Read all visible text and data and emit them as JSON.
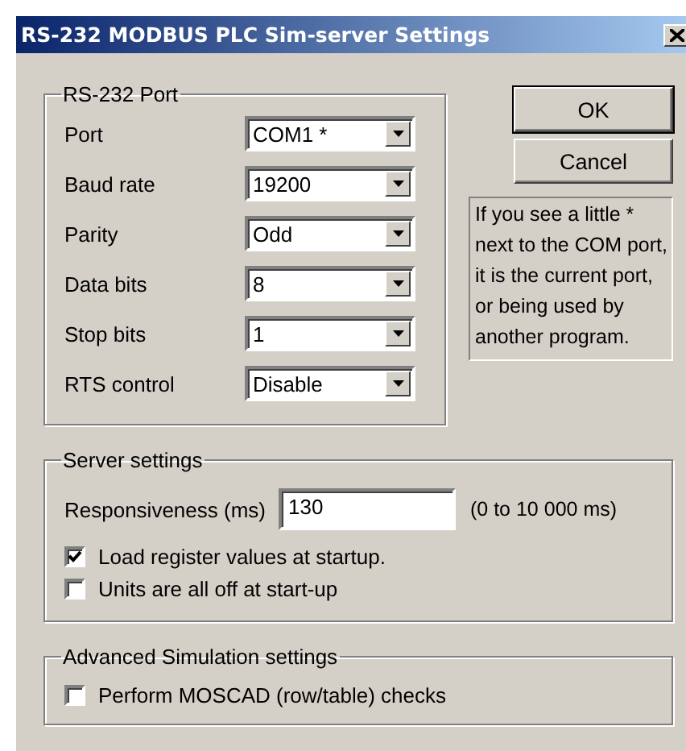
{
  "window": {
    "title": "RS-232 MODBUS PLC Sim-server Settings"
  },
  "port_group": {
    "title": "RS-232 Port",
    "fields": [
      {
        "label": "Port",
        "value": "COM1 *"
      },
      {
        "label": "Baud rate",
        "value": "19200"
      },
      {
        "label": "Parity",
        "value": "Odd"
      },
      {
        "label": "Data bits",
        "value": "8"
      },
      {
        "label": "Stop bits",
        "value": "1"
      },
      {
        "label": "RTS control",
        "value": "Disable"
      }
    ]
  },
  "buttons": [
    {
      "label": "OK",
      "default": true
    },
    {
      "label": "Cancel",
      "default": false
    }
  ],
  "note": "If you see a little * next to the COM port, it is the current port, or being used by another program.",
  "server_group": {
    "title": "Server settings",
    "responsiveness": {
      "label": "Responsiveness (ms)",
      "value": "130",
      "range": "(0 to 10 000 ms)"
    },
    "options": [
      {
        "label": "Load register values at startup.",
        "checked": true
      },
      {
        "label": "Units are all off at start-up",
        "checked": false
      }
    ]
  },
  "advanced_group": {
    "title": "Advanced Simulation settings",
    "options": [
      {
        "label": "Perform MOSCAD (row/table) checks",
        "checked": false
      }
    ]
  }
}
